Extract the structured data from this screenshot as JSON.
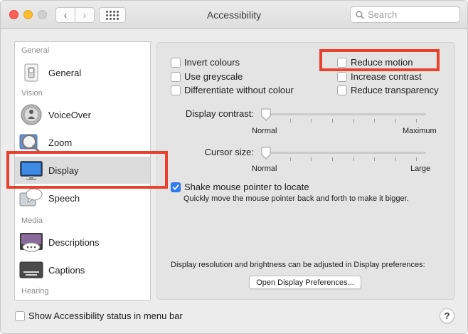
{
  "window": {
    "title": "Accessibility"
  },
  "toolbar": {
    "back_symbol": "‹",
    "forward_symbol": "›"
  },
  "search": {
    "placeholder": "Search",
    "value": ""
  },
  "sidebar": {
    "sections": [
      {
        "header": "General",
        "items": [
          {
            "label": "General",
            "icon": "general-switch-icon"
          }
        ]
      },
      {
        "header": "Vision",
        "items": [
          {
            "label": "VoiceOver",
            "icon": "voiceover-icon"
          },
          {
            "label": "Zoom",
            "icon": "zoom-icon"
          },
          {
            "label": "Display",
            "icon": "display-icon",
            "selected": true
          },
          {
            "label": "Speech",
            "icon": "speech-bubble-icon"
          }
        ]
      },
      {
        "header": "Media",
        "items": [
          {
            "label": "Descriptions",
            "icon": "descriptions-icon"
          },
          {
            "label": "Captions",
            "icon": "captions-icon"
          }
        ]
      },
      {
        "header": "Hearing",
        "items": []
      }
    ]
  },
  "display": {
    "options_left": [
      {
        "label": "Invert colours",
        "checked": false
      },
      {
        "label": "Use greyscale",
        "checked": false
      },
      {
        "label": "Differentiate without colour",
        "checked": false
      }
    ],
    "options_right": [
      {
        "label": "Reduce motion",
        "checked": false
      },
      {
        "label": "Increase contrast",
        "checked": false
      },
      {
        "label": "Reduce transparency",
        "checked": false
      }
    ],
    "contrast": {
      "label": "Display contrast:",
      "min_label": "Normal",
      "max_label": "Maximum",
      "value": 0
    },
    "cursor": {
      "label": "Cursor size:",
      "min_label": "Normal",
      "max_label": "Large",
      "value": 0
    },
    "shake": {
      "label": "Shake mouse pointer to locate",
      "checked": true,
      "description": "Quickly move the mouse pointer back and forth to make it bigger."
    },
    "resolution_note": "Display resolution and brightness can be adjusted in Display preferences:",
    "open_prefs_button": "Open Display Preferences..."
  },
  "footer": {
    "status_label": "Show Accessibility status in menu bar",
    "status_checked": false,
    "help_symbol": "?"
  },
  "colors": {
    "accent": "#2f7cf6",
    "highlight": "#e8422f",
    "selected_row": "#dcdcdc"
  }
}
